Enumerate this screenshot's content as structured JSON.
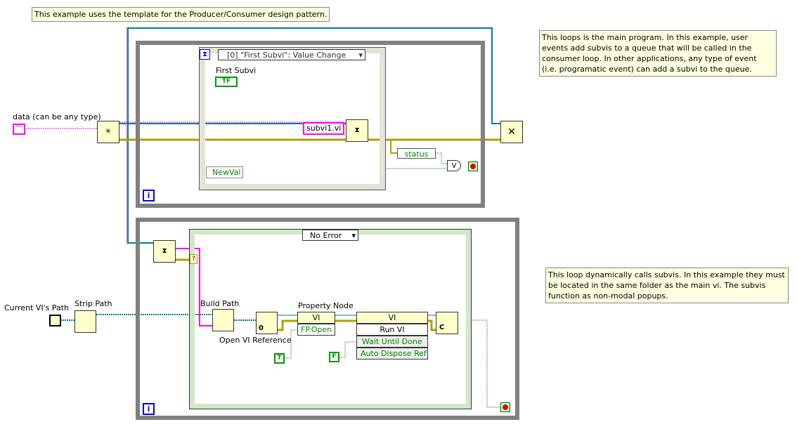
{
  "comments": {
    "top": "This example uses the template for the Producer/Consumer design pattern.",
    "main_loop": "This loops is the main program.  In this example, user events add subvis to a queue that will be called in the consumer loop. In other applications, any type of event (i.e. programatic event) can add a subvi to the queue.",
    "consumer_loop": "This loop dynamically calls subvis.  In this example they must be located in the same folder as the main vi.  The subvis function as non-modal popups."
  },
  "producer": {
    "data_label": "data (can be any type)",
    "data_constant": "\"\"",
    "event_case": "[0] \"First Subvi\": Value Change",
    "first_subvi_label": "First Subvi",
    "first_subvi_terminal": "TF",
    "string_constant": "subvi1.vi",
    "newval": "NewVal",
    "status": "status",
    "or": "V",
    "iteration": "i"
  },
  "consumer": {
    "case_selector": "No Error",
    "current_vi_path": "Current VI's Path",
    "strip_path": "Strip Path",
    "build_path": "Build Path",
    "open_vi_ref": "Open VI Reference",
    "open_zero": "0",
    "property_node": "Property Node",
    "prop_class": "VI",
    "prop_item": "FP.Open",
    "invoke_class": "VI",
    "invoke_method": "Run VI",
    "invoke_params": [
      "Wait Until Done",
      "Auto Dispose Ref"
    ],
    "true_const": "T",
    "false_const": "F",
    "close_ref": "C",
    "unknown": "?",
    "iteration": "i"
  },
  "colors": {
    "queue_wire": "#008080",
    "string_wire": "#ff00ff",
    "error_wire": "#b0a000",
    "bool_wire": "#008000",
    "loop_border": "#808080"
  }
}
